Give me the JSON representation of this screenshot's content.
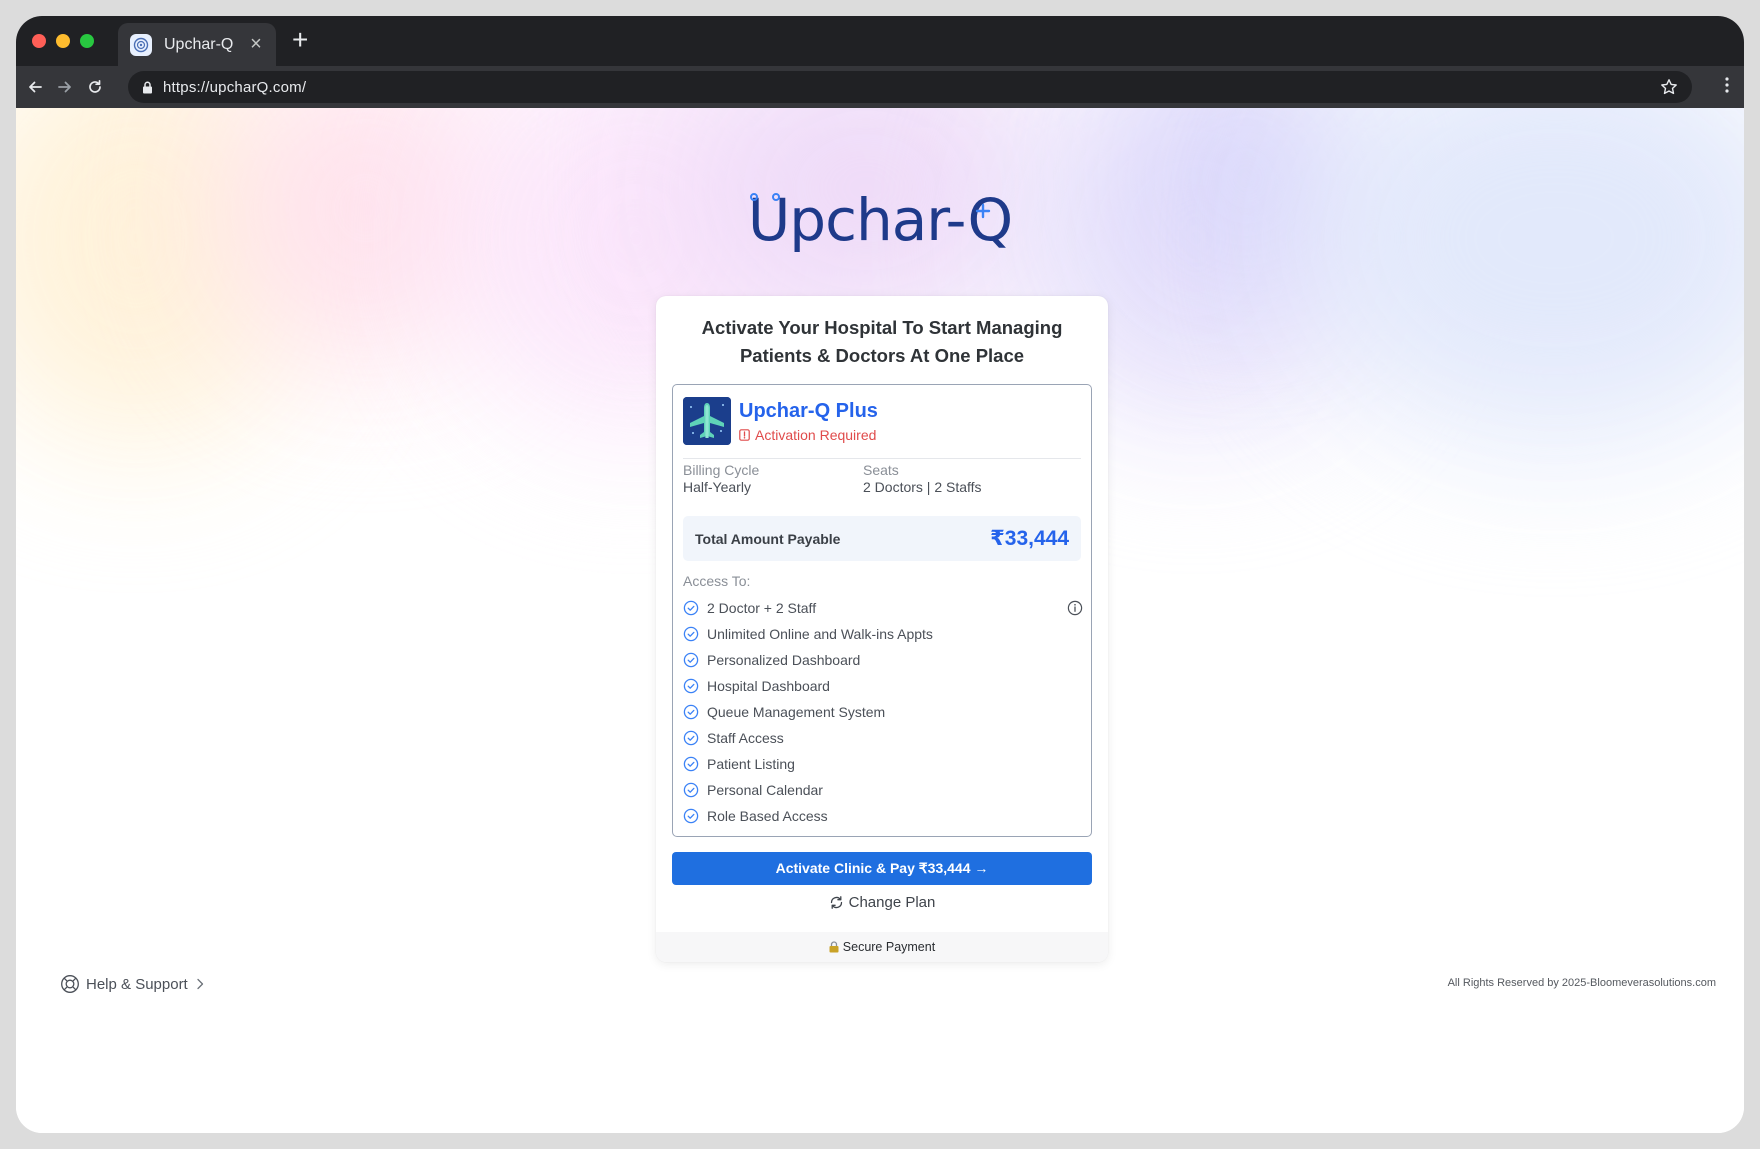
{
  "browser": {
    "tab_title": "Upchar-Q",
    "new_tab_label": "+",
    "url": "https://upcharQ.com/",
    "icons": [
      "back-icon",
      "forward-icon",
      "reload-icon",
      "lock-icon",
      "star-icon",
      "menu-icon",
      "close-icon"
    ]
  },
  "brand": {
    "logo_text": "Upchar-Q",
    "color": "#1e3a8a"
  },
  "card": {
    "heading_line1": "Activate Your Hospital To Start Managing",
    "heading_line2": "Patients & Doctors At One Place",
    "plan": {
      "name": "Upchar-Q Plus",
      "status": "Activation Required",
      "billing_cycle_label": "Billing Cycle",
      "billing_cycle_value": "Half-Yearly",
      "seats_label": "Seats",
      "seats_value": "2 Doctors | 2 Staffs",
      "total_label": "Total Amount Payable",
      "total_value": "₹33,444",
      "access_title": "Access To:",
      "features": [
        "2 Doctor + 2 Staff",
        "Unlimited Online and Walk-ins Appts",
        "Personalized Dashboard",
        "Hospital Dashboard",
        "Queue Management System",
        "Staff Access",
        "Patient Listing",
        "Personal Calendar",
        "Role Based Access"
      ]
    },
    "pay_button": "Activate Clinic & Pay ₹33,444 →",
    "change_plan": "Change Plan",
    "secure_payment": "Secure Payment"
  },
  "footer": {
    "help": "Help & Support",
    "copyright": "All Rights Reserved by 2025-Bloomeverasolutions.com"
  },
  "colors": {
    "primary": "#2563eb",
    "button": "#1f6fe0",
    "error": "#e04b4b"
  }
}
